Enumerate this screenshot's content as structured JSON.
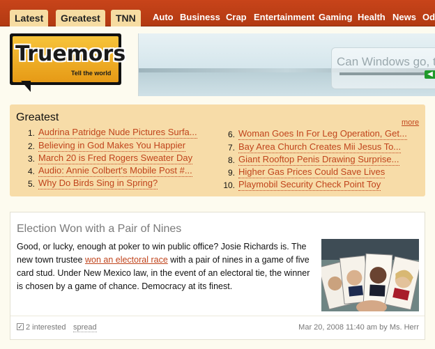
{
  "nav": {
    "tabs": [
      "Latest",
      "Greatest",
      "TNN"
    ],
    "categories": [
      "Auto",
      "Business",
      "Crap",
      "Entertainment",
      "Gaming",
      "Health",
      "News",
      "Odd"
    ]
  },
  "logo": {
    "name": "Truemors",
    "tagline": "Tell the world"
  },
  "banner": {
    "text": "Can Windows go, t",
    "button": "◀"
  },
  "greatest": {
    "title": "Greatest",
    "more": "more",
    "items": [
      {
        "num": "1.",
        "text": "Audrina Patridge Nude Pictures Surfa..."
      },
      {
        "num": "2.",
        "text": "Believing in God Makes You Happier"
      },
      {
        "num": "3.",
        "text": "March 20 is Fred Rogers Sweater Day"
      },
      {
        "num": "4.",
        "text": "Audio: Annie Colbert's Mobile Post #..."
      },
      {
        "num": "5.",
        "text": "Why Do Birds Sing in Spring?"
      },
      {
        "num": "6.",
        "text": "Woman Goes In For Leg Operation, Get..."
      },
      {
        "num": "7.",
        "text": "Bay Area Church Creates Mii Jesus To..."
      },
      {
        "num": "8.",
        "text": "Giant Rooftop Penis Drawing Surprise..."
      },
      {
        "num": "9.",
        "text": "Higher Gas Prices Could Save Lives"
      },
      {
        "num": "10.",
        "text": "Playmobil Security Check Point Toy"
      }
    ]
  },
  "article": {
    "title": "Election Won with a Pair of Nines",
    "body_part1": "Good, or lucky, enough at poker to win public office? Josie Richards is. The new town trustee ",
    "link": "won an electoral race",
    "body_part2": " with a pair of nines in a game of five card stud. Under New Mexico law, in the event of an electoral tie, the winner is chosen by a game of chance. Democracy at its finest.",
    "interested": "2 interested",
    "spread": "spread",
    "meta": "Mar 20, 2008 11:40 am by Ms. Herr"
  }
}
